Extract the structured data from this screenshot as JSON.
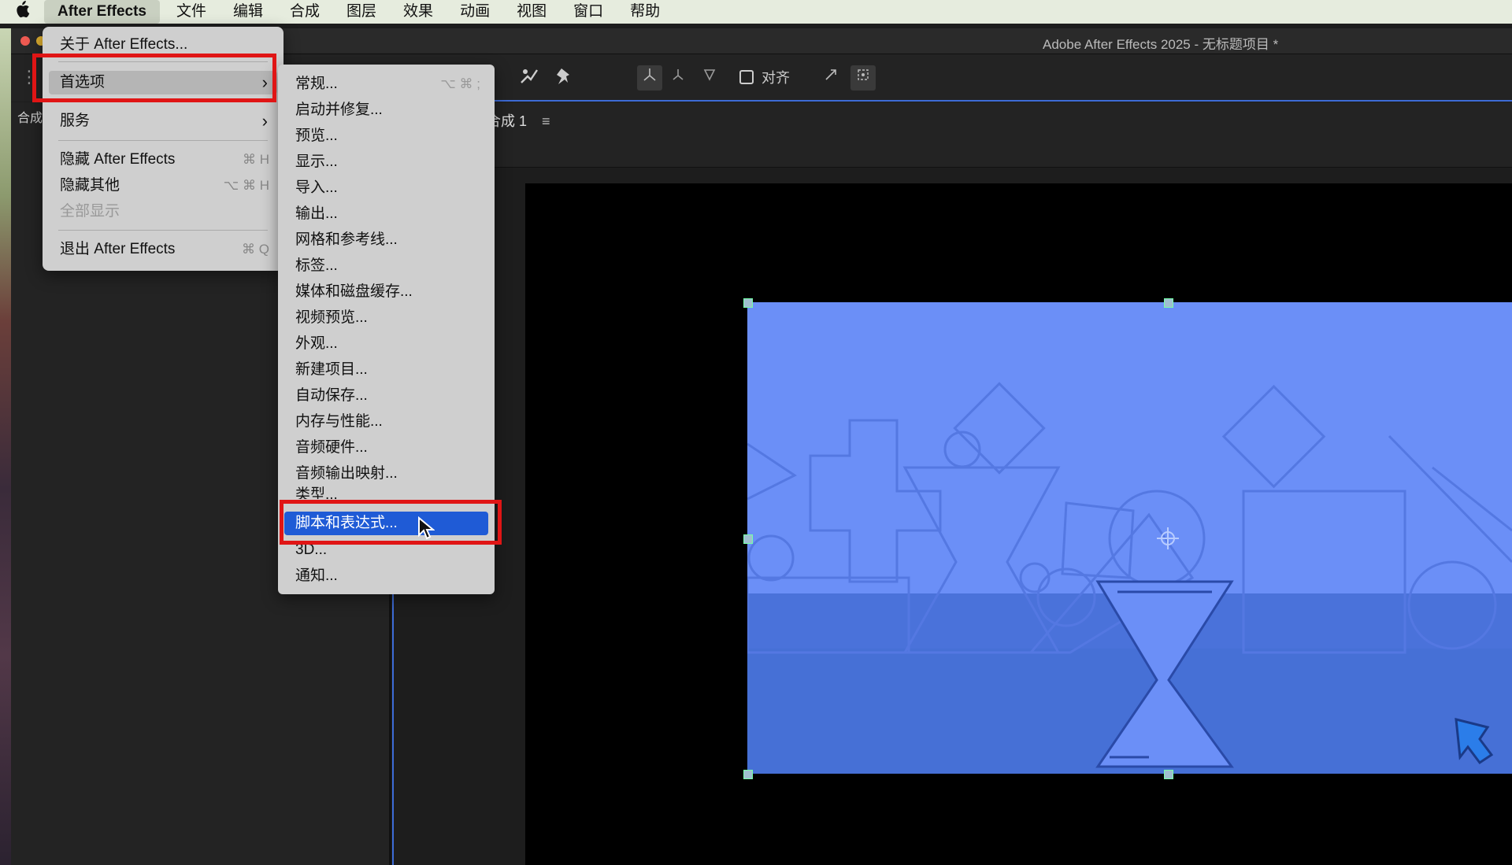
{
  "menubar": {
    "apple": "",
    "items": [
      "After Effects",
      "文件",
      "编辑",
      "合成",
      "图层",
      "效果",
      "动画",
      "视图",
      "窗口",
      "帮助"
    ]
  },
  "window": {
    "title": "Adobe After Effects 2025 - 无标题项目 *"
  },
  "toolbar": {
    "align_label": "对齐"
  },
  "left_panel": {
    "tab": "合成"
  },
  "comp_panel": {
    "tab": "合成 1",
    "menu_icon": "≡"
  },
  "app_menu": {
    "items": [
      {
        "label": "关于 After Effects...",
        "shortcut": ""
      },
      {
        "label": "首选项",
        "shortcut": "",
        "submenu": true
      },
      {
        "label": "服务",
        "shortcut": "",
        "submenu": true
      },
      {
        "label": "隐藏 After Effects",
        "shortcut": "⌘ H"
      },
      {
        "label": "隐藏其他",
        "shortcut": "⌥ ⌘ H"
      },
      {
        "label": "全部显示",
        "shortcut": "",
        "disabled": true
      },
      {
        "label": "退出 After Effects",
        "shortcut": "⌘ Q"
      }
    ]
  },
  "prefs_submenu": {
    "items": [
      {
        "label": "常规...",
        "shortcut": "⌥ ⌘ ;"
      },
      {
        "label": "启动并修复..."
      },
      {
        "label": "预览..."
      },
      {
        "label": "显示..."
      },
      {
        "label": "导入..."
      },
      {
        "label": "输出..."
      },
      {
        "label": "网格和参考线..."
      },
      {
        "label": "标签..."
      },
      {
        "label": "媒体和磁盘缓存..."
      },
      {
        "label": "视频预览..."
      },
      {
        "label": "外观..."
      },
      {
        "label": "新建项目..."
      },
      {
        "label": "自动保存..."
      },
      {
        "label": "内存与性能..."
      },
      {
        "label": "音频硬件..."
      },
      {
        "label": "音频输出映射..."
      },
      {
        "label": "类型..."
      },
      {
        "label": "脚本和表达式..."
      },
      {
        "label": "3D..."
      },
      {
        "label": "通知..."
      }
    ],
    "highlighted_index": 17
  },
  "colors": {
    "highlight": "#1f5bd6",
    "annotation_red": "#e01515",
    "comp_blue": "#6b8ff7"
  }
}
